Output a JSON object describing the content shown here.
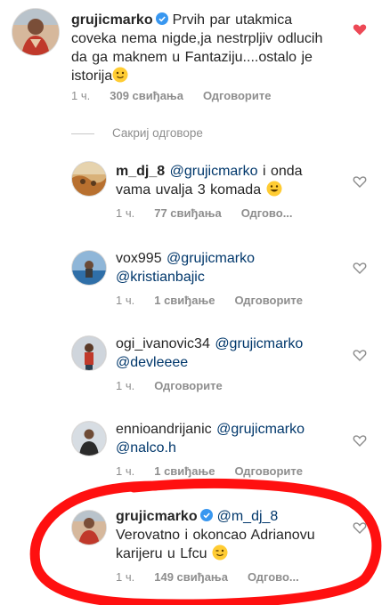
{
  "colors": {
    "text": "#262626",
    "meta": "#8e8e8e",
    "mention": "#00376b",
    "liked_heart": "#ed4956",
    "verified": "#3897f0",
    "annotation_red": "#ff1010"
  },
  "main_comment": {
    "username": "grujicmarko",
    "verified": true,
    "text_1": "Prvih par utakmica",
    "text_2": "coveka nema nigde,ja nestrpljiv odlucih",
    "text_3": "da ga maknem u Fantaziju....ostalo je",
    "text_4": "istorija",
    "emoji": "slightly-smiling-face",
    "time": "1 ч.",
    "likes": "309 свиђања",
    "reply": "Одговорите",
    "liked": true
  },
  "hide_replies_label": "Сакриј одговоре",
  "replies": [
    {
      "username": "m_dj_8",
      "mention": "@grujicmarko",
      "text_1": "i onda",
      "text_2": "vama uvalja 3 komada",
      "emoji": "grinning-face",
      "time": "1 ч.",
      "likes": "77 свиђања",
      "reply": "Одгово..."
    },
    {
      "username": "vox995",
      "mention": "@grujicmarko",
      "mention_2": "@kristianbajic",
      "time": "1 ч.",
      "likes": "1 свиђање",
      "reply": "Одговорите"
    },
    {
      "username": "ogi_ivanovic34",
      "mention": "@grujicmarko",
      "mention_2": "@devleeee",
      "time": "1 ч.",
      "reply": "Одговорите"
    },
    {
      "username": "ennioandrijanic",
      "mention": "@grujicmarko",
      "mention_2": "@nalco.h",
      "time": "1 ч.",
      "likes": "1 свиђање",
      "reply": "Одговорите"
    },
    {
      "username": "grujicmarko",
      "verified": true,
      "mention": "@m_dj_8",
      "text_1": "Verovatno i okoncao Adrianovu",
      "text_2": "karijeru u Lfcu",
      "emoji": "winking-face",
      "time": "1 ч.",
      "likes": "149 свиђања",
      "reply": "Одгово..."
    }
  ]
}
